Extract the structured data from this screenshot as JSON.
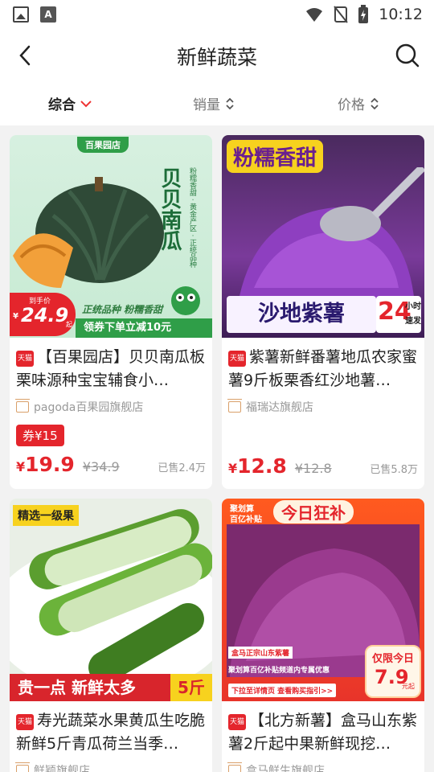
{
  "status_bar": {
    "time": "10:12"
  },
  "header": {
    "title": "新鲜蔬菜"
  },
  "sort": [
    {
      "label": "综合",
      "active": true,
      "icon": "chevron-down-icon"
    },
    {
      "label": "销量",
      "active": false,
      "icon": "sort-updown-icon"
    },
    {
      "label": "价格",
      "active": false,
      "icon": "sort-updown-icon"
    }
  ],
  "products": [
    {
      "title": "【百果园店】贝贝南瓜板栗味源种宝宝辅食小…",
      "badge": "天猫",
      "shop": "pagoda百果园旗舰店",
      "coupon": "券¥15",
      "price": "19.9",
      "price_symbol": "¥",
      "original_price": "¥34.9",
      "sold": "已售2.4万",
      "image": {
        "logo": "百果园店",
        "name": "贝贝南瓜",
        "tags": "粉糯香甜 · 黄金产区 · 正统品种",
        "promo_label": "到手价",
        "promo_price": "24.9",
        "promo_suffix": "起",
        "line1": "正统品种 粉糯香甜",
        "line2": "领券下单立减10元"
      }
    },
    {
      "title": "紫薯新鲜番薯地瓜农家蜜薯9斤板栗香红沙地薯…",
      "badge": "天猫",
      "shop": "福瑞达旗舰店",
      "coupon": "",
      "price": "12.8",
      "price_symbol": "¥",
      "original_price": "¥12.8",
      "sold": "已售5.8万",
      "image": {
        "top": "粉糯香甜",
        "bottom": "沙地紫薯",
        "hours": "24",
        "hours_unit": "小时",
        "fast": "速发"
      }
    },
    {
      "title": "寿光蔬菜水果黄瓜生吃脆新鲜5斤青瓜荷兰当季…",
      "badge": "天猫",
      "shop": "鲜颖旗舰店",
      "image": {
        "tag": "精选一级果",
        "bottom": "贵一点  新鲜太多",
        "weight": "5斤"
      }
    },
    {
      "title": "【北方新薯】盒马山东紫薯2斤起中果新鲜现挖…",
      "badge": "天猫",
      "shop": "盒马鲜生旗舰店",
      "image": {
        "tag1": "聚划算",
        "tag2": "百亿补贴",
        "banner": "今日狂补",
        "left_tag": "盒马正宗山东紫薯",
        "desc": "聚划算百亿补贴频道内专属优惠",
        "link": "下拉至详情页 查看购买指引>>",
        "limit": "仅限今日",
        "limit_price": "7.9",
        "limit_unit": "元起"
      }
    }
  ]
}
